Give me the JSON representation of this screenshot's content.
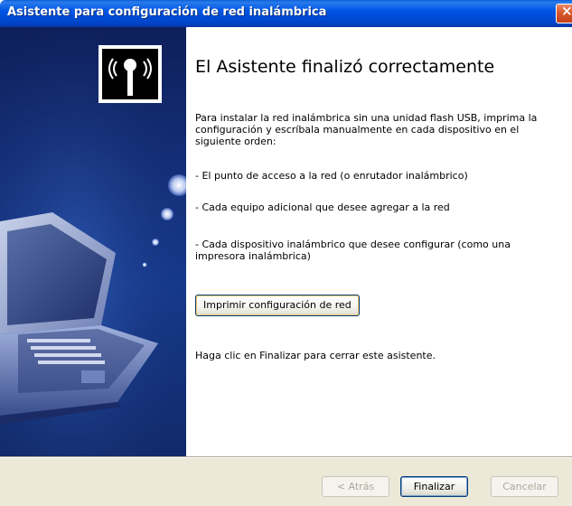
{
  "window": {
    "title": "Asistente para configuración de red inalámbrica",
    "close_glyph": "×"
  },
  "left_panel": {
    "logo_icon": "wireless-antenna-icon",
    "illustration": "laptop-illustration"
  },
  "content": {
    "heading": "El Asistente finalizó correctamente",
    "intro": "Para instalar la red inalámbrica sin una unidad flash USB, imprima la configuración y escríbala manualmente en cada dispositivo en el siguiente orden:",
    "item1": "- El punto de acceso a la red (o enrutador inalámbrico)",
    "item2": "- Cada equipo adicional que desee agregar a la red",
    "item3": "- Cada dispositivo inalámbrico que desee configurar (como una impresora inalámbrica)",
    "print_button": "Imprimir configuración de red",
    "finish_hint": "Haga clic en Finalizar para cerrar este asistente."
  },
  "footer": {
    "back_button": "< Atrás",
    "finish_button": "Finalizar",
    "cancel_button": "Cancelar"
  },
  "colors": {
    "titlebar": "#0055e5",
    "panel_blue": "#14307a",
    "dialog_gray": "#ece9d8"
  }
}
